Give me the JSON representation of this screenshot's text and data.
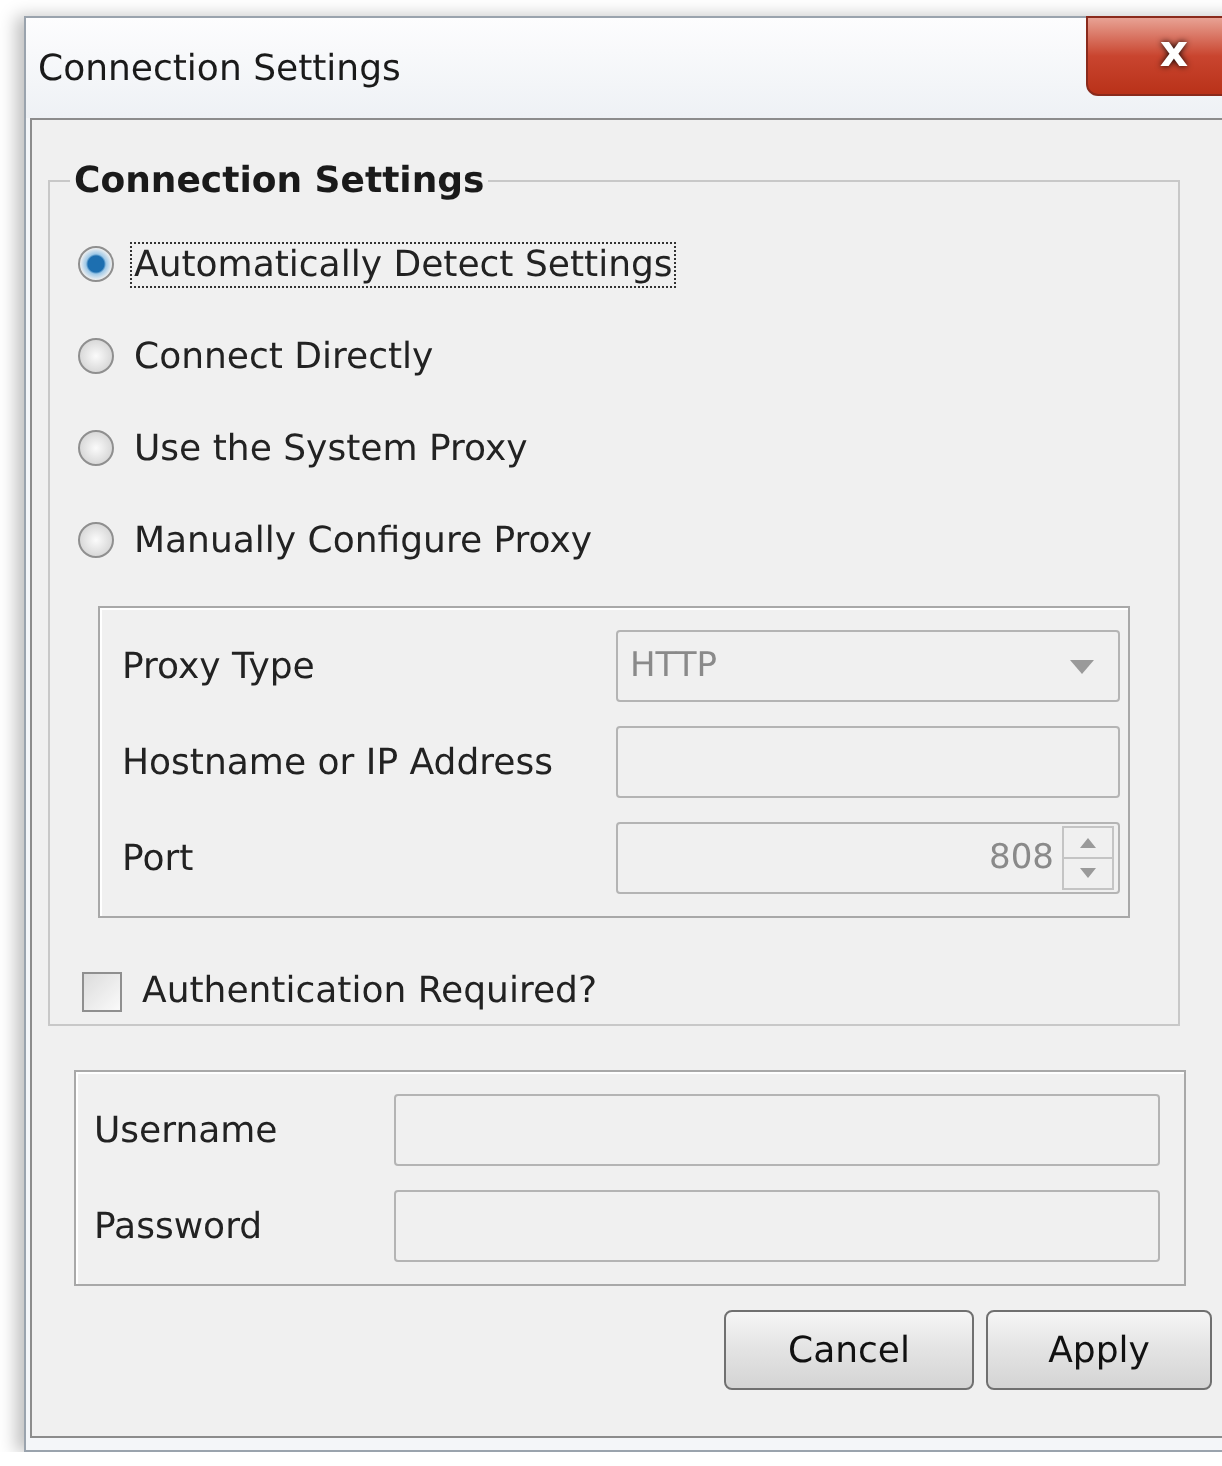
{
  "window": {
    "title": "Connection Settings",
    "close": "x"
  },
  "group": {
    "title": "Connection Settings"
  },
  "options": [
    {
      "label": "Automatically Detect Settings",
      "selected": true,
      "focused": true
    },
    {
      "label": "Connect Directly",
      "selected": false,
      "focused": false
    },
    {
      "label": "Use the System Proxy",
      "selected": false,
      "focused": false
    },
    {
      "label": "Manually Configure Proxy",
      "selected": false,
      "focused": false
    }
  ],
  "proxy": [
    {
      "label": "Proxy Type",
      "kind": "dropdown",
      "value": "HTTP",
      "disabled": true
    },
    {
      "label": "Hostname or IP Address",
      "kind": "text",
      "disabled": true
    },
    {
      "label": "Port",
      "kind": "spinner",
      "value": "808",
      "disabled": true
    }
  ],
  "auth": {
    "label": "Authentication Required?",
    "checked": false
  },
  "credentials": [
    {
      "label": "Username",
      "disabled": true
    },
    {
      "label": "Password",
      "disabled": true
    }
  ],
  "buttons": [
    "Cancel",
    "Apply"
  ]
}
